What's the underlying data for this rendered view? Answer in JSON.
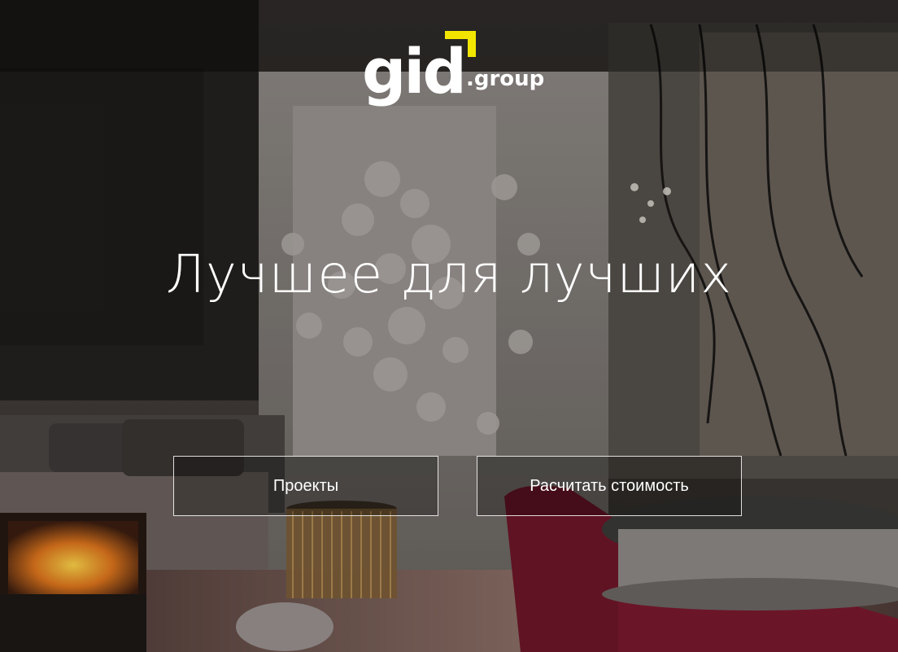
{
  "brand": {
    "logo_text": "gid",
    "logo_suffix": ".group",
    "accent_color": "#f2e600"
  },
  "hero": {
    "headline": "Лучшее для лучших"
  },
  "actions": {
    "projects_label": "Проекты",
    "calculate_label": "Расчитать стоимость"
  }
}
